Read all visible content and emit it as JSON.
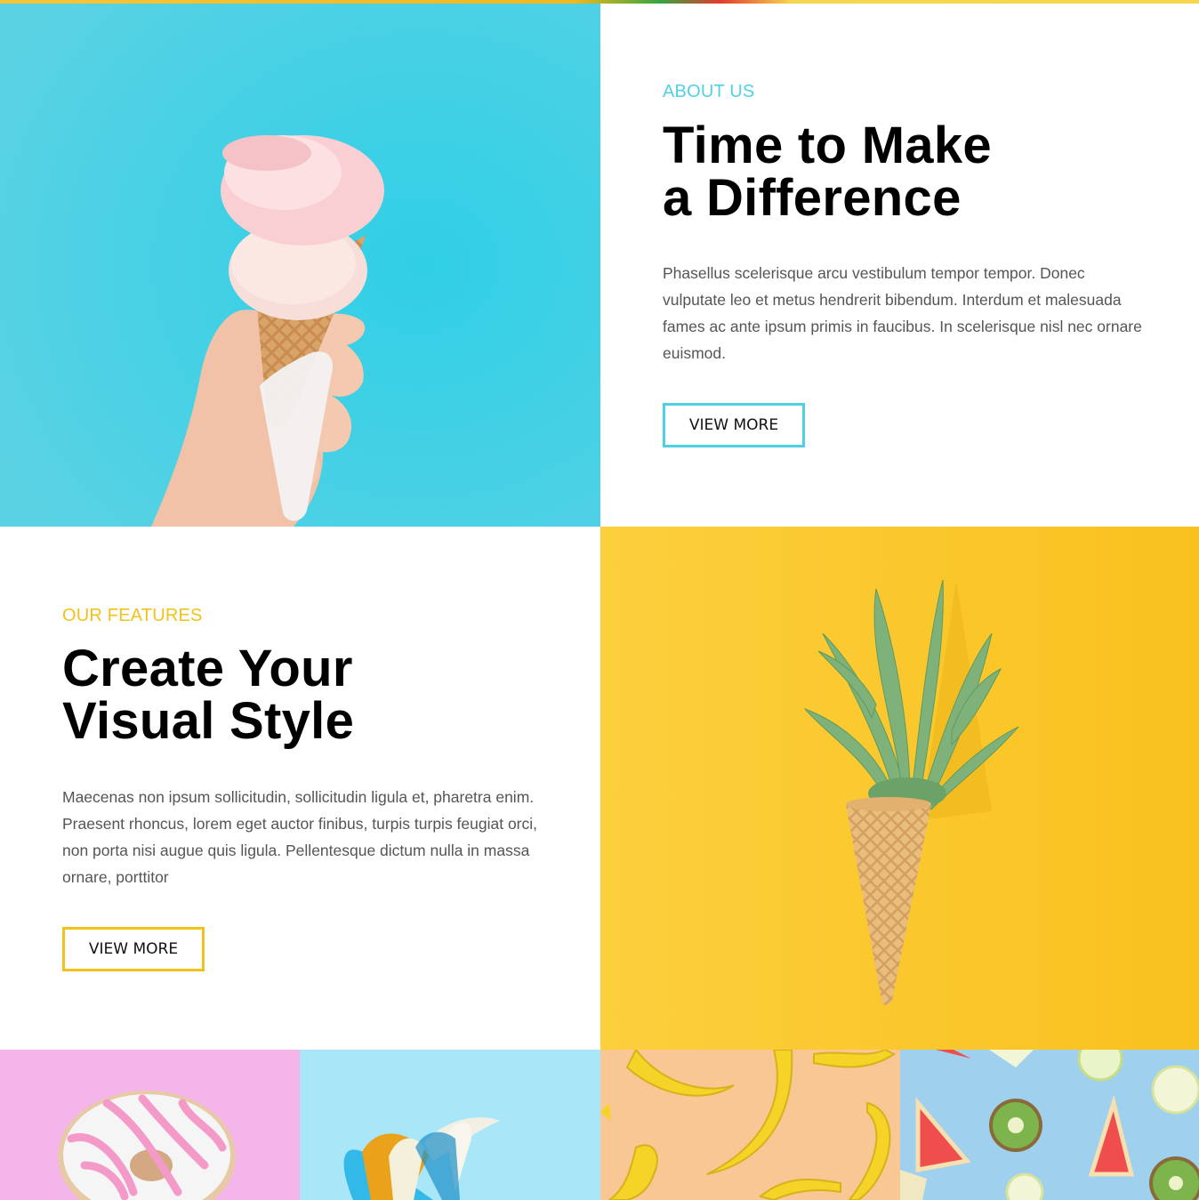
{
  "about": {
    "eyebrow": "ABOUT US",
    "heading": "Time to Make\na Difference",
    "body": "Phasellus scelerisque arcu vestibulum tempor tempor. Donec vulputate leo et metus hendrerit bibendum. Interdum et malesuada fames ac ante ipsum primis in faucibus. In scelerisque nisl nec ornare euismod.",
    "button_label": "VIEW MORE",
    "accent_color": "#4fd1e3"
  },
  "features": {
    "eyebrow": "OUR FEATURES",
    "heading": "Create Your\nVisual Style",
    "body": "Maecenas non ipsum sollicitudin, sollicitudin ligula et, pharetra enim. Praesent rhoncus, lorem eget auctor finibus, turpis turpis feugiat orci, non porta nisi augue quis ligula. Pellentesque dictum nulla in massa ornare, porttitor",
    "button_label": "VIEW MORE",
    "accent_color": "#f1c21b"
  },
  "images": {
    "ice_cream": "ice-cream-cone-in-hand photo",
    "pineapple_cone": "pineapple-in-waffle-cone photo",
    "gallery": [
      "donut photo",
      "peeled-banana photo",
      "bananas photo",
      "citrus-and-kiwi photo"
    ]
  },
  "colors": {
    "cyan_bg": "#3ed0e6",
    "yellow_bg": "#fbc925",
    "pink_bg": "#f3b5ea",
    "light_blue_bg": "#a9e6f7",
    "peach_bg": "#f9c794",
    "sky_blue_bg": "#9fd0ee"
  }
}
